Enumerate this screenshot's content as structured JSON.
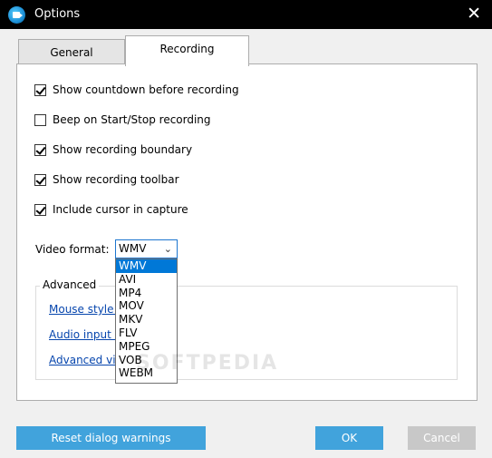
{
  "window": {
    "title": "Options"
  },
  "tabs": {
    "general": "General",
    "recording": "Recording"
  },
  "options": [
    {
      "label": "Show countdown before recording",
      "checked": true
    },
    {
      "label": "Beep on Start/Stop recording",
      "checked": false
    },
    {
      "label": "Show recording boundary",
      "checked": true
    },
    {
      "label": "Show recording toolbar",
      "checked": true
    },
    {
      "label": "Include cursor in capture",
      "checked": true
    }
  ],
  "video_format": {
    "label": "Video format:",
    "selected": "WMV",
    "options": [
      "WMV",
      "AVI",
      "MP4",
      "MOV",
      "MKV",
      "FLV",
      "MPEG",
      "VOB",
      "WEBM"
    ]
  },
  "advanced": {
    "title": "Advanced",
    "links": [
      "Mouse style s",
      "Audio input s",
      "Advanced vid"
    ]
  },
  "watermark": "SOFTPEDIA",
  "buttons": {
    "reset": "Reset dialog warnings",
    "ok": "OK",
    "cancel": "Cancel"
  },
  "colors": {
    "titlebar": "#000000",
    "accent": "#41a3dc",
    "selection": "#0078d7",
    "link": "#0645ad"
  }
}
